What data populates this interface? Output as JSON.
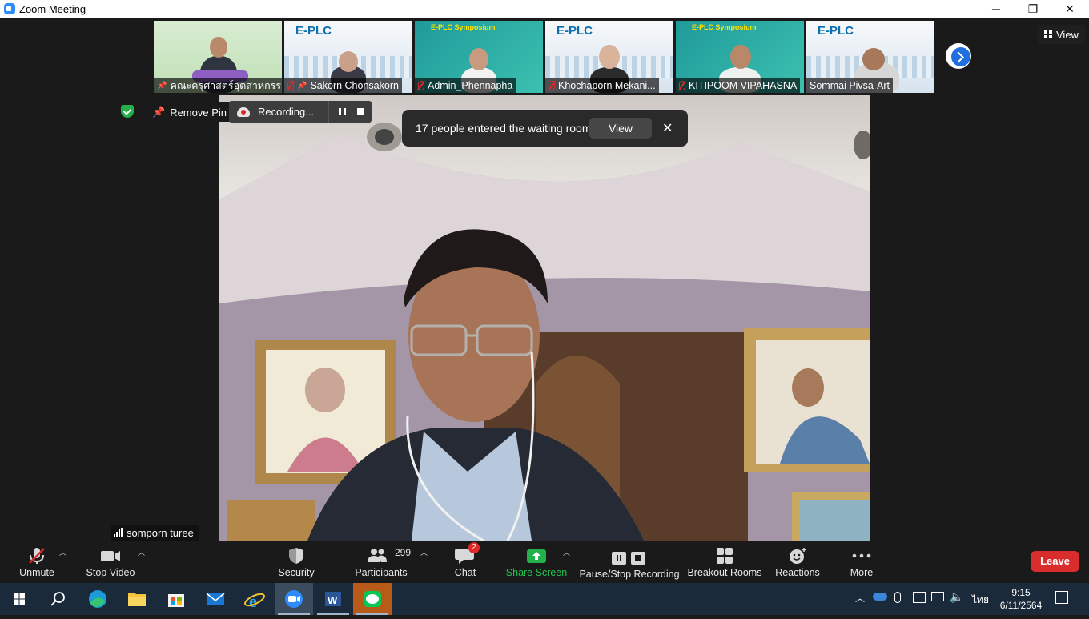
{
  "window": {
    "title": "Zoom Meeting",
    "minimize": "─",
    "maximize": "❐",
    "close": "✕"
  },
  "filmstrip": {
    "participants": [
      {
        "name": "คณะครุศาสตร์อุตสาหกรร...",
        "state": "pinned"
      },
      {
        "name": "Sakorn  Chonsakorn",
        "state": "muted-pinned"
      },
      {
        "name": "Admin_Phennapha",
        "state": "muted"
      },
      {
        "name": "Khochaporn Mekani...",
        "state": "muted"
      },
      {
        "name": "KITIPOOM VIPAHASNA",
        "state": "muted"
      },
      {
        "name": "Sommai Pivsa-Art",
        "state": "none"
      }
    ],
    "banner_text": "E-PLC Symposium",
    "logo_text": "E-PLC"
  },
  "top_view_button": "View",
  "pin_button": "Remove Pin",
  "recording": {
    "label": "Recording..."
  },
  "waiting_room": {
    "message": "17 people entered the waiting room",
    "view_label": "View",
    "close": "✕"
  },
  "speaker": {
    "name": "somporn turee"
  },
  "toolbar": {
    "unmute": "Unmute",
    "stop_video": "Stop Video",
    "security": "Security",
    "participants": "Participants",
    "participants_count": "299",
    "chat": "Chat",
    "chat_badge": "2",
    "share_screen": "Share Screen",
    "recording": "Pause/Stop Recording",
    "breakout": "Breakout Rooms",
    "reactions": "Reactions",
    "more": "More",
    "leave": "Leave"
  },
  "taskbar": {
    "language": "ไทย",
    "time": "9:15",
    "date": "6/11/2564"
  },
  "colors": {
    "accent": "#2d8cff",
    "leave": "#d92c2c",
    "share": "#23b04a",
    "badge": "#e02828"
  }
}
